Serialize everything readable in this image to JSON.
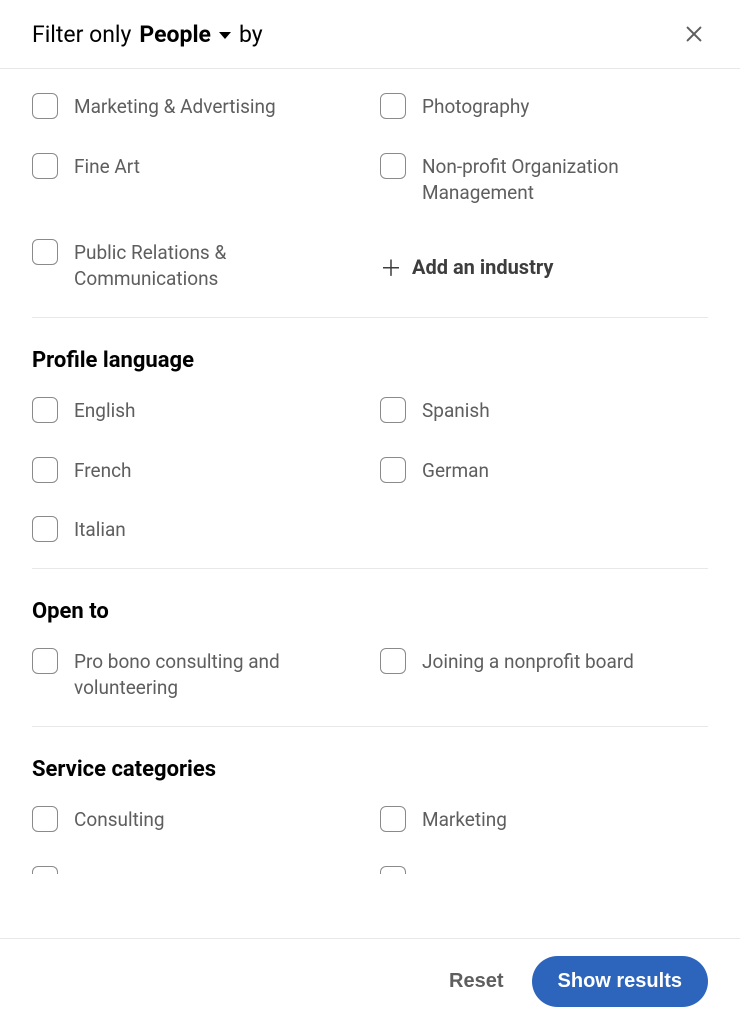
{
  "header": {
    "prefix": "Filter only",
    "dropdown_label": "People",
    "suffix": "by"
  },
  "sections": {
    "industry": {
      "options": [
        "Marketing & Advertising",
        "Photography",
        "Fine Art",
        "Non-profit Organization Management",
        "Public Relations & Communications"
      ],
      "add_label": "Add an industry"
    },
    "profile_language": {
      "title": "Profile language",
      "options": [
        "English",
        "Spanish",
        "French",
        "German",
        "Italian"
      ]
    },
    "open_to": {
      "title": "Open to",
      "options": [
        "Pro bono consulting and volunteering",
        "Joining a nonprofit board"
      ]
    },
    "service_categories": {
      "title": "Service categories",
      "options": [
        "Consulting",
        "Marketing"
      ]
    }
  },
  "footer": {
    "reset_label": "Reset",
    "show_results_label": "Show results"
  }
}
